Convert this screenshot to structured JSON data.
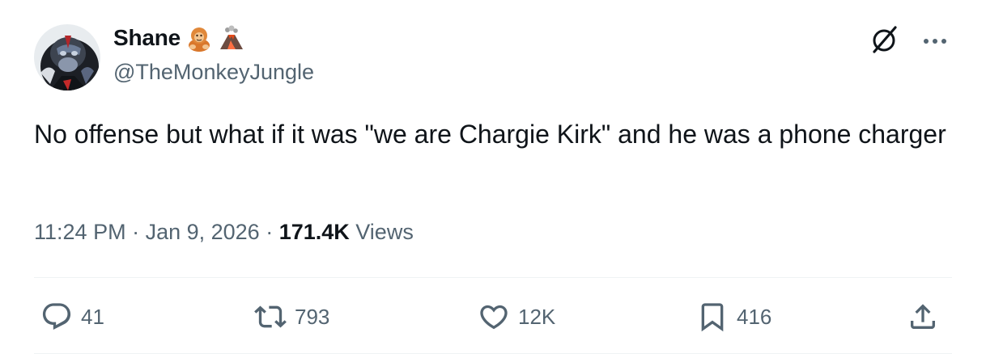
{
  "author": {
    "display_name": "Shane",
    "emoji_icons": [
      "orangutan-emoji",
      "volcano-emoji"
    ],
    "handle": "@TheMonkeyJungle"
  },
  "tweet": {
    "text": "No offense but what if it was \"we are Chargie Kirk\" and he was a phone charger"
  },
  "meta": {
    "time": "11:24 PM",
    "dot1": " · ",
    "date": "Jan 9, 2026",
    "dot2": " · ",
    "views_count": "171.4K",
    "views_label": " Views"
  },
  "actions": {
    "replies": "41",
    "reposts": "793",
    "likes": "12K",
    "bookmarks": "416"
  },
  "colors": {
    "text_primary": "#0f1419",
    "text_secondary": "#536471",
    "divider": "#eff3f4"
  },
  "icons": {
    "top_right": [
      "grok-icon",
      "more-icon"
    ],
    "actions": [
      "reply-icon",
      "repost-icon",
      "like-icon",
      "bookmark-icon",
      "share-icon"
    ]
  }
}
